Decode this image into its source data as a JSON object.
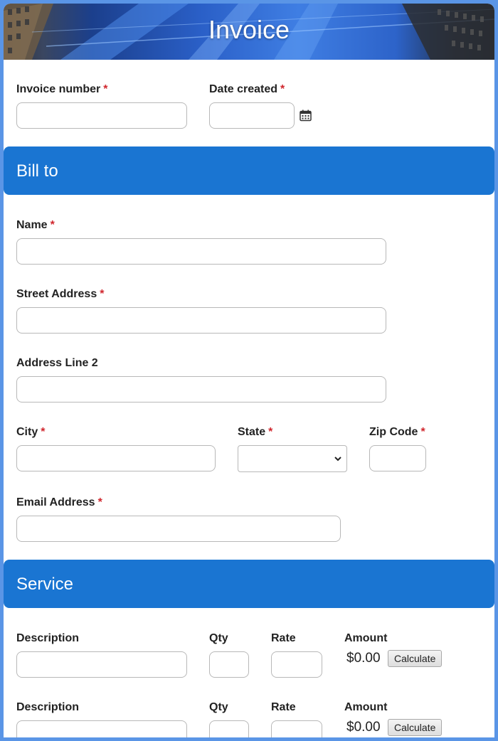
{
  "header": {
    "title": "Invoice"
  },
  "required_marker": "*",
  "fields": {
    "invoice_number": {
      "label": "Invoice number",
      "value": ""
    },
    "date_created": {
      "label": "Date created",
      "value": ""
    },
    "name": {
      "label": "Name",
      "value": ""
    },
    "street_address": {
      "label": "Street Address",
      "value": ""
    },
    "address_line2": {
      "label": "Address Line 2",
      "value": ""
    },
    "city": {
      "label": "City",
      "value": ""
    },
    "state": {
      "label": "State",
      "selected": ""
    },
    "zip": {
      "label": "Zip Code",
      "value": ""
    },
    "email": {
      "label": "Email Address",
      "value": ""
    }
  },
  "sections": {
    "bill_to": "Bill to",
    "service": "Service"
  },
  "service_rows": [
    {
      "description_label": "Description",
      "qty_label": "Qty",
      "rate_label": "Rate",
      "amount_label": "Amount",
      "amount": "$0.00",
      "calc_label": "Calculate"
    },
    {
      "description_label": "Description",
      "qty_label": "Qty",
      "rate_label": "Rate",
      "amount_label": "Amount",
      "amount": "$0.00",
      "calc_label": "Calculate"
    }
  ],
  "colors": {
    "page_border": "#5a95e6",
    "section_bar": "#1a75d2",
    "required": "#d0262d"
  },
  "icons": {
    "date_picker": "calendar-icon",
    "select_arrow": "chevron-down-icon"
  }
}
